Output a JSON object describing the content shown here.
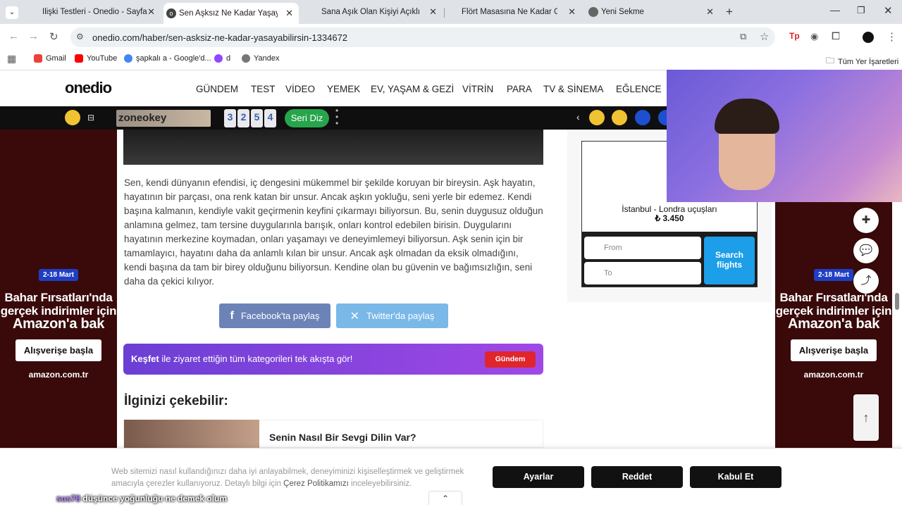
{
  "browser": {
    "tabs": [
      {
        "title": "İlişki Testleri - Onedio - Sayfa 5",
        "active": false
      },
      {
        "title": "Sen Aşksız Ne Kadar Yaşayabilir",
        "active": true
      },
      {
        "title": "Sana Aşık Olan Kişiyi Açıklıyoru",
        "active": false
      },
      {
        "title": "Flört Masasına Ne Kadar Güçlü",
        "active": false
      },
      {
        "title": "Yeni Sekme",
        "active": false
      }
    ],
    "url": "onedio.com/haber/sen-asksiz-ne-kadar-yasayabilirsin-1334672",
    "bookmarks": [
      {
        "label": "Gmail"
      },
      {
        "label": "YouTube"
      },
      {
        "label": "şapkalı a - Google'd..."
      },
      {
        "label": "d"
      },
      {
        "label": "Yandex"
      }
    ],
    "all_bookmarks": "Tüm Yer İşaretleri"
  },
  "site": {
    "logo": "onedio",
    "nav": [
      "GÜNDEM",
      "TEST",
      "VİDEO",
      "YEMEK",
      "EV, YAŞAM & GEZİ",
      "VİTRİN",
      "PARA",
      "TV & SİNEMA",
      "EĞLENCE"
    ]
  },
  "gamebar": {
    "zone": "zoneokey",
    "numbers": [
      "3",
      "2",
      "5",
      "4"
    ],
    "seri": "Seri Diz"
  },
  "ad": {
    "badge": "2-18 Mart",
    "line1": "Bahar Fırsatları'nda",
    "line2": "gerçek indirimler için",
    "line3": "Amazon'a bak",
    "button": "Alışverişe başla",
    "brand": "amazon.com.tr"
  },
  "article": {
    "paragraph": "Sen, kendi dünyanın efendisi, iç dengesini mükemmel bir şekilde koruyan bir bireysin. Aşk hayatın, hayatının bir parçası, ona renk katan bir unsur. Ancak aşkın yokluğu, seni yerle bir edemez. Kendi başına kalmanın, kendiyle vakit geçirmenin keyfini çıkarmayı biliyorsun. Bu, senin duygusuz olduğun anlamına gelmez, tam tersine duygularınla barışık, onları kontrol edebilen birisin. Duygularını hayatının merkezine koymadan, onları yaşamayı ve deneyimlemeyi biliyorsun. Aşk senin için bir tamamlayıcı, hayatını daha da anlamlı kılan bir unsur. Ancak aşk olmadan da eksik olmadığını, kendi başına da tam bir birey olduğunu biliyorsun. Kendine olan bu güvenin ve bağımsızlığın, seni daha da çekici kılıyor.",
    "share_facebook": "Facebook'ta paylaş",
    "share_twitter": "Twitter'da paylaş",
    "kesfet_bold": "Keşfet",
    "kesfet_text": " ile ziyaret ettiğin tüm kategorileri tek akışta gör!",
    "gundem_btn": "Gündem",
    "related_heading": "İlginizi çekebilir:",
    "related_title": "Senin Nasıl Bir Sevgi Dilin Var?"
  },
  "flight_widget": {
    "route": "İstanbul - Londra uçuşları",
    "price": "₺ 3.450",
    "from_placeholder": "From",
    "to_placeholder": "To",
    "search_line1": "Search",
    "search_line2": "flights"
  },
  "cookie": {
    "text_before": "Web sitemizi nasıl kullandığınızı daha iyi anlayabilmek, deneyiminizi kişiselleştirmek ve geliştirmek amacıyla çerezler kullanıyoruz. Detaylı bilgi için ",
    "link": "Çerez Politikamızı",
    "text_after": " inceleyebilirsiniz.",
    "btn_settings": "Ayarlar",
    "btn_reject": "Reddet",
    "btn_accept": "Kabul Et"
  },
  "caption": {
    "user": "sus78",
    "text": "düşünce yoğunluğu ne demek olum"
  }
}
